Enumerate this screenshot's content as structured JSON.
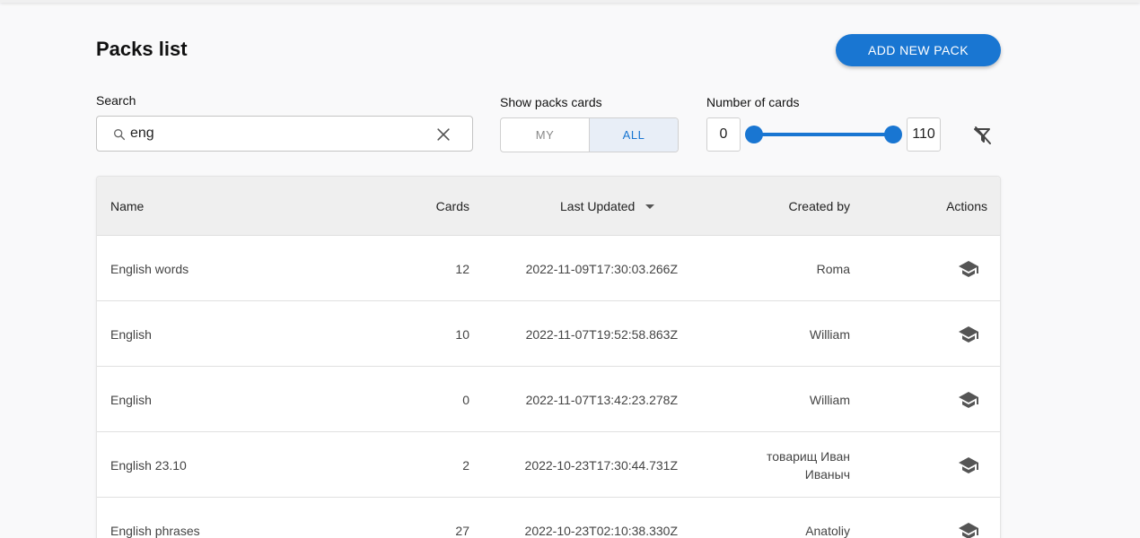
{
  "page": {
    "title": "Packs list",
    "add_button": "ADD NEW PACK"
  },
  "filters": {
    "search_label": "Search",
    "search_value": "eng",
    "show_label": "Show packs cards",
    "show_options": [
      "MY",
      "ALL"
    ],
    "show_selected": "ALL",
    "number_label": "Number of cards",
    "min_value": "0",
    "max_value": "110"
  },
  "table": {
    "headers": {
      "name": "Name",
      "cards": "Cards",
      "updated": "Last Updated",
      "created": "Created by",
      "actions": "Actions"
    },
    "sort": {
      "column": "Last Updated",
      "direction": "desc"
    },
    "rows": [
      {
        "name": "English words",
        "cards": "12",
        "updated": "2022-11-09T17:30:03.266Z",
        "created_line1": "Roma",
        "created_line2": "",
        "action_icon": "graduation-cap-icon"
      },
      {
        "name": "English",
        "cards": "10",
        "updated": "2022-11-07T19:52:58.863Z",
        "created_line1": "William",
        "created_line2": "",
        "action_icon": "graduation-cap-icon"
      },
      {
        "name": "English",
        "cards": "0",
        "updated": "2022-11-07T13:42:23.278Z",
        "created_line1": "William",
        "created_line2": "",
        "action_icon": "graduation-cap-icon"
      },
      {
        "name": "English 23.10",
        "cards": "2",
        "updated": "2022-10-23T17:30:44.731Z",
        "created_line1": "товарищ Иван",
        "created_line2": "Иваныч",
        "action_icon": "graduation-cap-icon"
      },
      {
        "name": "English phrases",
        "cards": "27",
        "updated": "2022-10-23T02:10:38.330Z",
        "created_line1": "Anatoliy",
        "created_line2": "",
        "action_icon": "graduation-cap-icon"
      }
    ]
  },
  "icons": {
    "search": "search-icon",
    "clear": "close-icon",
    "reset_filters": "filter-off-icon"
  },
  "colors": {
    "accent": "#1976d2",
    "header_bg": "#efefef",
    "page_bg": "#f9f9fa"
  }
}
